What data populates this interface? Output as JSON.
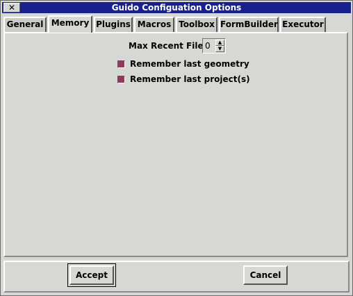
{
  "window": {
    "title": "Guido Configuation Options",
    "close_glyph": "✕"
  },
  "tabs": [
    {
      "label": "General",
      "active": false
    },
    {
      "label": "Memory",
      "active": true
    },
    {
      "label": "Plugins",
      "active": false
    },
    {
      "label": "Macros",
      "active": false
    },
    {
      "label": "Toolbox",
      "active": false
    },
    {
      "label": "FormBuilder",
      "active": false
    },
    {
      "label": "Executor",
      "active": false
    }
  ],
  "memory": {
    "max_recent_files_label": "Max Recent Files",
    "max_recent_files_value": "0",
    "remember_geometry_label": "Remember last geometry",
    "remember_geometry_checked": true,
    "remember_projects_label": "Remember last project(s)",
    "remember_projects_checked": true
  },
  "buttons": {
    "accept": "Accept",
    "cancel": "Cancel"
  },
  "colors": {
    "titlebar": "#1a1f8e",
    "checkbox_fill": "#8e3b5f"
  }
}
